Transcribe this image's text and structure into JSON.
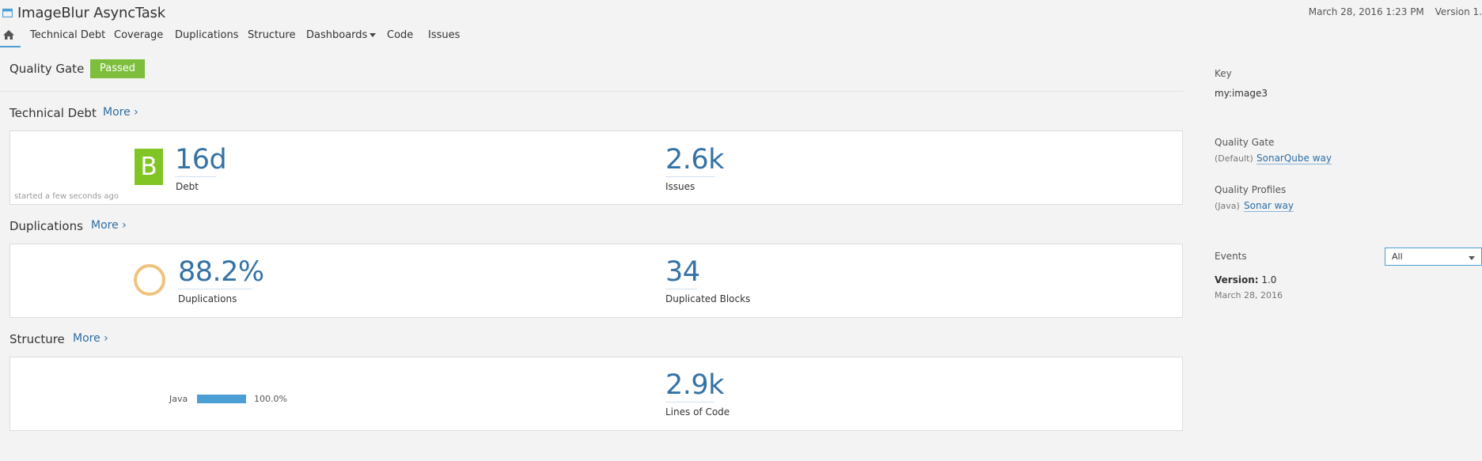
{
  "header": {
    "app_title": "ImageBlur AsyncTask",
    "date": "March 28, 2016 1:23 PM",
    "version": "Version 1."
  },
  "nav": {
    "items": [
      "Technical Debt",
      "Coverage",
      "Duplications",
      "Structure",
      "Dashboards",
      "Code",
      "Issues"
    ]
  },
  "quality_gate": {
    "label": "Quality Gate",
    "status": "Passed",
    "status_color": "#7dbf3c"
  },
  "technical_debt": {
    "title": "Technical Debt",
    "more": "More",
    "rating": "B",
    "rating_color": "#81c525",
    "debt_value": "16d",
    "debt_label": "Debt",
    "issues_value": "2.6k",
    "issues_label": "Issues",
    "started": "started a few seconds ago"
  },
  "duplications": {
    "title": "Duplications",
    "more": "More",
    "value": "88.2%",
    "label": "Duplications",
    "blocks_value": "34",
    "blocks_label": "Duplicated Blocks"
  },
  "structure": {
    "title": "Structure",
    "more": "More",
    "language": "Java",
    "language_pct": "100.0%",
    "loc_value": "2.9k",
    "loc_label": "Lines of Code"
  },
  "sidebar": {
    "key_label": "Key",
    "key_value": "my:image3",
    "qg_label": "Quality Gate",
    "qg_default": "(Default)",
    "qg_link": "SonarQube way",
    "qp_label": "Quality Profiles",
    "qp_lang": "(Java)",
    "qp_link": "Sonar way",
    "events_label": "Events",
    "events_filter": "All",
    "event_version_label": "Version:",
    "event_version": "1.0",
    "event_date": "March 28, 2016"
  },
  "colors": {
    "accent": "#4b9fd5",
    "link": "#2d6ea3",
    "metric": "#3572a5",
    "ring": "#f0c27d"
  }
}
